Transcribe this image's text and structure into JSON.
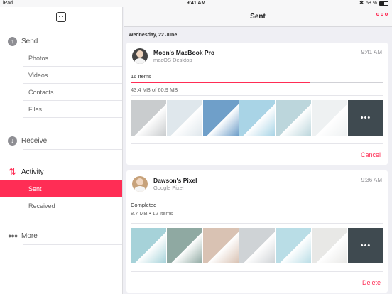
{
  "status_bar": {
    "device": "iPad",
    "time": "9:41 AM",
    "battery": "58 %",
    "battery_level": 0.58
  },
  "sidebar": {
    "sections": {
      "send": "Send",
      "receive": "Receive",
      "activity": "Activity",
      "more": "More"
    },
    "send_items": [
      "Photos",
      "Videos",
      "Contacts",
      "Files"
    ],
    "activity_items": [
      "Sent",
      "Received"
    ],
    "selected": "Sent"
  },
  "header": {
    "title": "Sent"
  },
  "date_header": "Wednesday, 22 June",
  "transfers": [
    {
      "device": "Moon's MacBook Pro",
      "type": "macOS Desktop",
      "time": "9:41 AM",
      "status": "16 Items",
      "size": "43.4 MB of 60.9 MB",
      "progress": 0.71,
      "action": "Cancel",
      "thumbs": [
        "#c9ccce",
        "#dfe7ec",
        "#6f9fc9",
        "#a9d4e6",
        "#bcd6dc",
        "#eef1f2"
      ]
    },
    {
      "device": "Dawson's Pixel",
      "type": "Google Pixel",
      "time": "9:36 AM",
      "status": "Completed",
      "size": "8.7 MB • 12 Items",
      "action": "Delete",
      "thumbs": [
        "#a6d2d9",
        "#8fa9a2",
        "#d9c2b3",
        "#cfd3d6",
        "#b9dde6",
        "#e8e8e6"
      ]
    }
  ],
  "colors": {
    "accent": "#ff2d55"
  }
}
